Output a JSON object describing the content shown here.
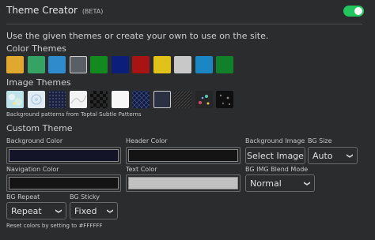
{
  "header": {
    "title": "Theme Creator",
    "beta": "(BETA)",
    "enabled": true
  },
  "description": "Use the given themes or create your own to use on the site.",
  "color_themes": {
    "label": "Color Themes",
    "swatches": [
      {
        "icon": "swatch",
        "color": "#e0a82e"
      },
      {
        "icon": "swatch",
        "color": "#34a364"
      },
      {
        "icon": "swatch",
        "color": "#2f8bcb"
      },
      {
        "icon": "swatch",
        "color": "#5a5f66",
        "selected": true
      },
      {
        "icon": "swatch",
        "color": "#138a1f"
      },
      {
        "icon": "swatch",
        "color": "#0b1f7a"
      },
      {
        "icon": "swatch",
        "color": "#a81313"
      },
      {
        "icon": "swatch",
        "color": "#e0c21a"
      },
      {
        "icon": "swatch",
        "color": "#c8c8c8"
      },
      {
        "icon": "swatch",
        "color": "#1a86c4"
      },
      {
        "icon": "swatch",
        "color": "#11802a"
      }
    ]
  },
  "image_themes": {
    "label": "Image Themes",
    "patterns": [
      "pattern-light-blue",
      "pattern-snowflake",
      "pattern-dark-navy",
      "pattern-white-lines",
      "pattern-black-checker",
      "pattern-white",
      "pattern-navy-geo",
      "pattern-slate-blue",
      "pattern-dark-diagonal",
      "pattern-dark-colorful",
      "pattern-black-dots"
    ],
    "selected_index": 7,
    "credit": "Background patterns from Toptal Subtle Patterns"
  },
  "custom_theme": {
    "label": "Custom Theme",
    "background_color": {
      "label": "Background Color",
      "value": "#141428"
    },
    "header_color": {
      "label": "Header Color",
      "value": "#141414"
    },
    "navigation_color": {
      "label": "Navigation Color",
      "value": "#141414"
    },
    "text_color": {
      "label": "Text Color",
      "value": "#c0c0c0"
    },
    "background_image": {
      "label": "Background Image",
      "button": "Select Image"
    },
    "bg_size": {
      "label": "BG Size",
      "value": "Auto"
    },
    "blend_mode": {
      "label": "BG IMG Blend Mode",
      "value": "Normal"
    },
    "bg_repeat": {
      "label": "BG Repeat",
      "value": "Repeat"
    },
    "bg_sticky": {
      "label": "BG Sticky",
      "value": "Fixed"
    },
    "reset_note": "Reset colors by setting to #FFFFFF"
  }
}
